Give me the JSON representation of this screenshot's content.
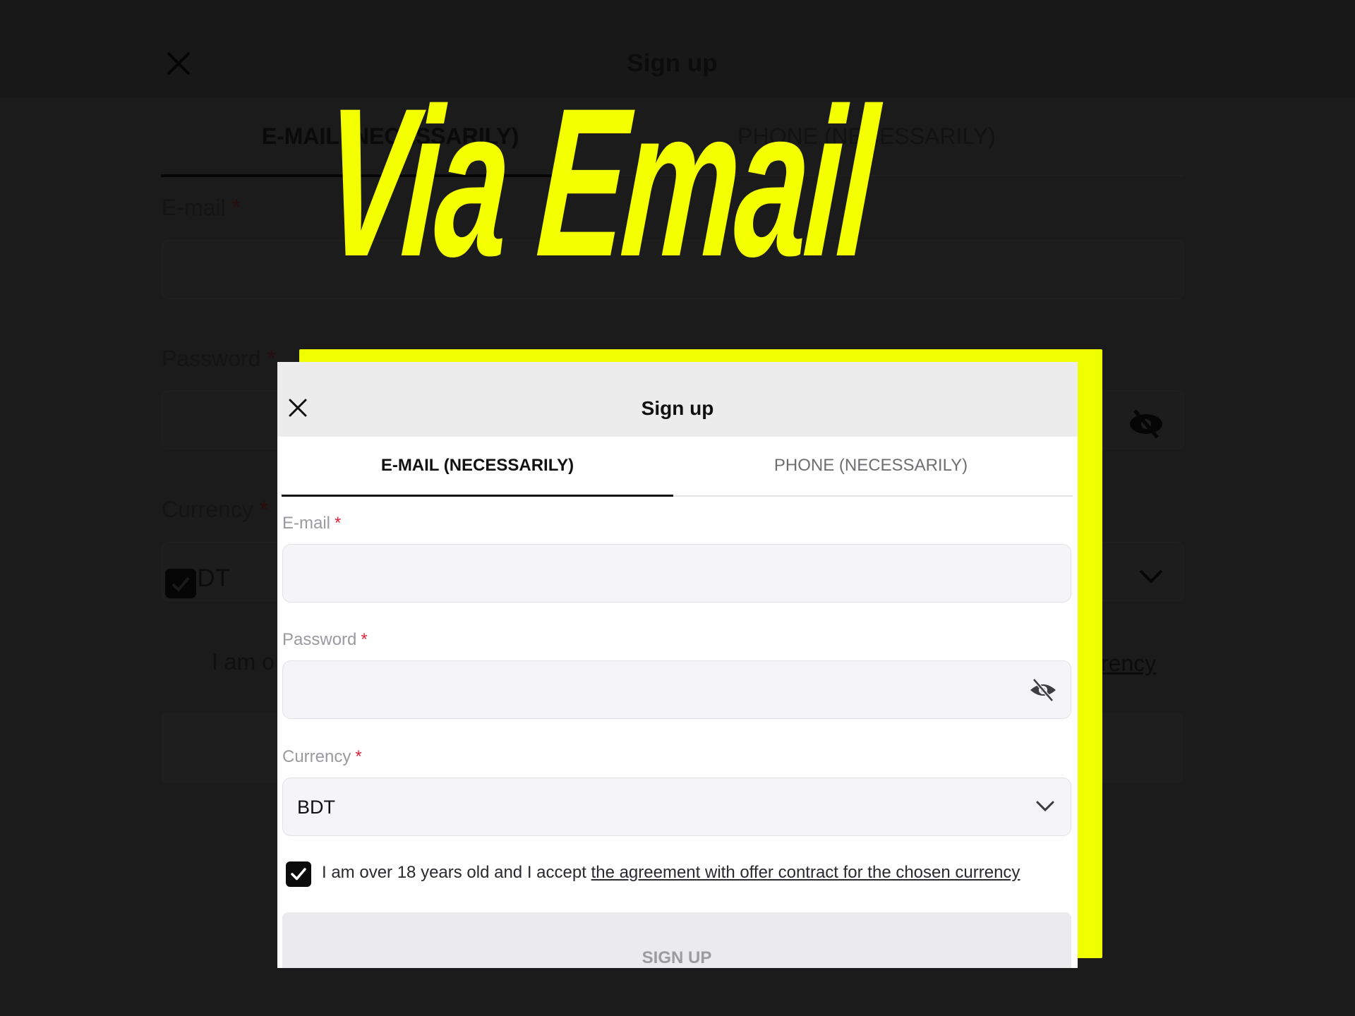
{
  "headline": "Via Email",
  "colors": {
    "accent": "#f0ff00",
    "headline": "#f4ff00",
    "background": "#1b1b1b",
    "required": "#e0263c"
  },
  "modal": {
    "title": "Sign up",
    "tabs": [
      {
        "label": "E-MAIL (NECESSARILY)",
        "active": true
      },
      {
        "label": "PHONE (NECESSARILY)",
        "active": false
      }
    ],
    "fields": {
      "email": {
        "label": "E-mail",
        "required_mark": "*",
        "value": "",
        "placeholder": ""
      },
      "password": {
        "label": "Password",
        "required_mark": "*",
        "value": "",
        "placeholder": "",
        "icon": "eye-slash-icon"
      },
      "currency": {
        "label": "Currency",
        "required_mark": "*",
        "selected": "BDT",
        "icon": "chevron-down-icon"
      }
    },
    "consent": {
      "checked": true,
      "text": "I am over 18 years old and I accept ",
      "link_text": "the agreement with offer contract for the chosen currency"
    },
    "submit_label": "SIGN UP",
    "close_icon": "close-icon"
  },
  "background_modal": {
    "title": "Sign up",
    "tabs": [
      "E-MAIL (NECESSARILY)",
      "PHONE (NECESSARILY)"
    ],
    "labels": {
      "email": "E-mail",
      "password": "Password",
      "currency": "Currency",
      "required_mark": "*"
    },
    "currency_value": "BDT",
    "consent_start": "I am o",
    "consent_end": "rency"
  }
}
